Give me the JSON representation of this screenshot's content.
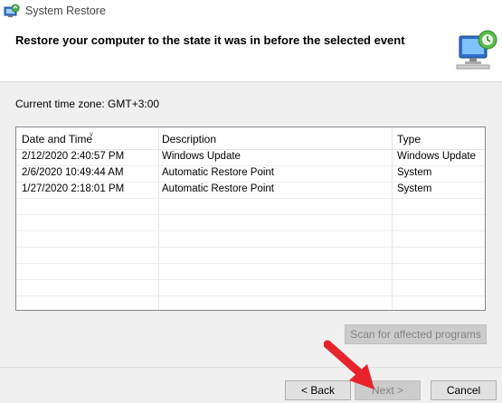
{
  "window": {
    "title": "System Restore",
    "icon": "system-restore-icon"
  },
  "header": {
    "title": "Restore your computer to the state it was in before the selected event",
    "icon": "monitor-restore-icon"
  },
  "timezone_label": "Current time zone: GMT+3:00",
  "table": {
    "columns": [
      "Date and Time",
      "Description",
      "Type"
    ],
    "rows": [
      [
        "2/12/2020 2:40:57 PM",
        "Windows Update",
        "Windows Update"
      ],
      [
        "2/6/2020 10:49:44 AM",
        "Automatic Restore Point",
        "System"
      ],
      [
        "1/27/2020 2:18:01 PM",
        "Automatic Restore Point",
        "System"
      ]
    ]
  },
  "buttons": {
    "scan": "Scan for affected programs",
    "back": "< Back",
    "next": "Next >",
    "cancel": "Cancel"
  },
  "colors": {
    "annotation_arrow": "#e8232b",
    "disabled_button": "#cccccc"
  }
}
